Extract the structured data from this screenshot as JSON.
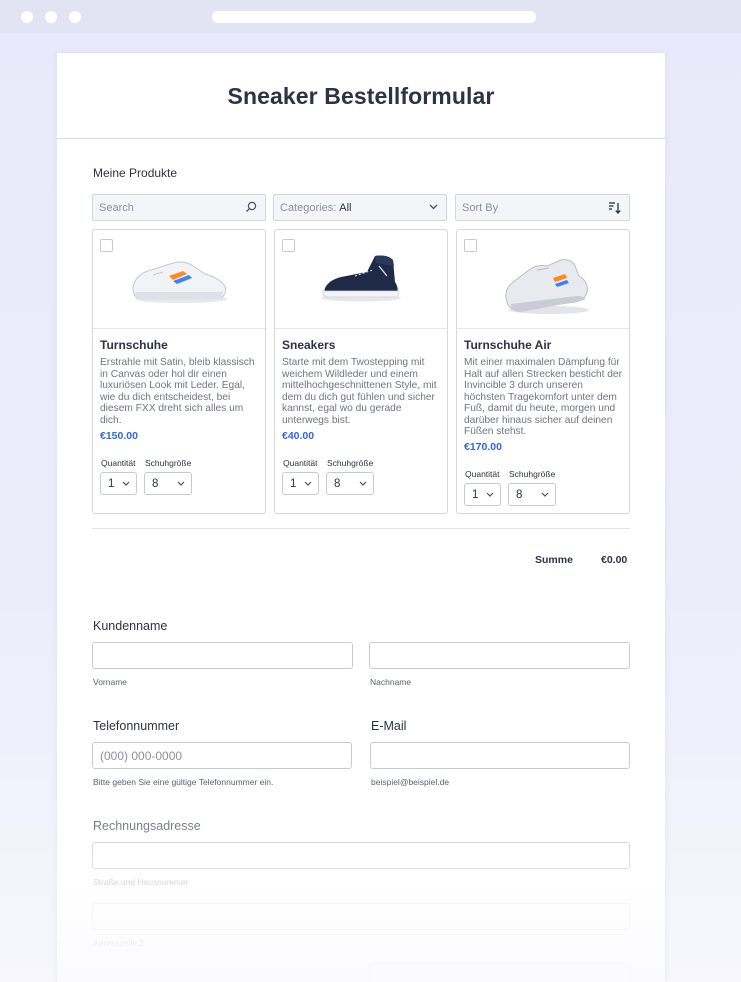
{
  "form": {
    "title": "Sneaker Bestellformular",
    "products_section_label": "Meine Produkte",
    "search": {
      "placeholder": "Search"
    },
    "categories": {
      "label": "Categories:",
      "value": "All"
    },
    "sort": {
      "label": "Sort By"
    },
    "products": [
      {
        "name": "Turnschuhe",
        "description": "Erstrahle mit Satin, bleib klassisch in Canvas oder hol dir einen luxuriösen Look mit Leder. Egal, wie du dich entscheidest, bei diesem FXX dreht sich alles um dich.",
        "price": "€150.00",
        "quantity_label": "Quantität",
        "size_label": "Schuhgröße",
        "quantity": "1",
        "size": "8"
      },
      {
        "name": "Sneakers",
        "description": "Starte mit dem Twostepping mit weichem Wildleder und einem mittelhochgeschnittenen Style, mit dem du dich gut fühlen und sicher kannst, egal wo du gerade unterwegs bist.",
        "price": "€40.00",
        "quantity_label": "Quantität",
        "size_label": "Schuhgröße",
        "quantity": "1",
        "size": "8"
      },
      {
        "name": "Turnschuhe Air",
        "description": "Mit einer maximalen Dämpfung für Halt auf allen Strecken besticht der Invincible 3 durch unseren höchsten Tragekomfort unter dem Fuß, damit du heute, morgen und darüber hinaus sicher auf deinen Füßen stehst.",
        "price": "€170.00",
        "quantity_label": "Quantität",
        "size_label": "Schuhgröße",
        "quantity": "1",
        "size": "8"
      }
    ],
    "summary": {
      "label": "Summe",
      "value": "€0.00"
    },
    "customer_name": {
      "label": "Kundenname",
      "first_sublabel": "Vorname",
      "last_sublabel": "Nachname"
    },
    "phone": {
      "label": "Telefonnummer",
      "placeholder": "(000) 000-0000",
      "sublabel": "Bitte geben Sie eine gültige Telefonnummer ein."
    },
    "email": {
      "label": "E-Mail",
      "sublabel": "beispiel@beispiel.de"
    },
    "billing": {
      "label": "Rechnungsadresse",
      "street_sublabel": "Straße und Hausnummer",
      "line2_sublabel": "Adresszeile 2"
    }
  },
  "colors": {
    "accent_price": "#2f66e6",
    "text": "#2c3345",
    "background": "#ebebfb"
  },
  "icons": {
    "search": "magnifier-icon",
    "dropdown": "chevron-down-icon",
    "sort": "sort-icon"
  }
}
